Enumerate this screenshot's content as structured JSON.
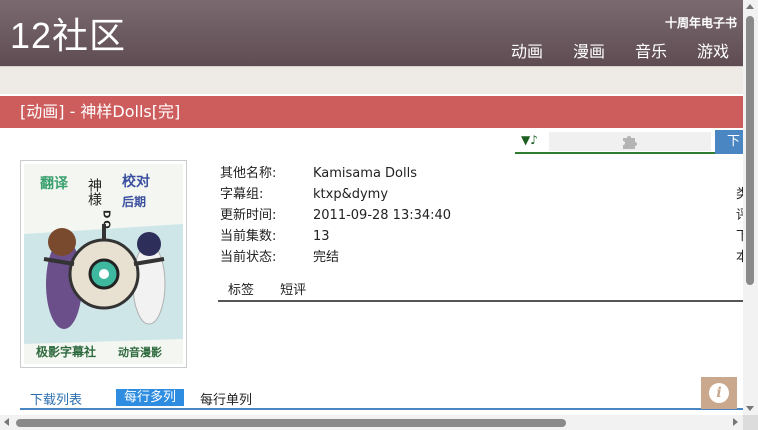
{
  "site": {
    "logo": "12社区",
    "tagline": "十周年电子书",
    "nav": [
      "动画",
      "漫画",
      "音乐",
      "游戏"
    ]
  },
  "page_title": "[动画] - 神样Dolls[完]",
  "player": {
    "note": "▼♪",
    "download_label": "下"
  },
  "cover": {
    "title_vertical": "神様",
    "title_latin": "DOLLS",
    "credits_left": [
      "翻译",
      "校对"
    ],
    "credits_right": [
      "后期"
    ],
    "bottom_left": "极影字幕社",
    "bottom_right": "动音漫影"
  },
  "info": {
    "rows": [
      {
        "key": "其他名称:",
        "value": "Kamisama Dolls"
      },
      {
        "key": "字幕组:",
        "value": "ktxp&dymy"
      },
      {
        "key": "更新时间:",
        "value": "2011-09-28 13:34:40"
      },
      {
        "key": "当前集数:",
        "value": "13"
      },
      {
        "key": "当前状态:",
        "value": "完结"
      }
    ],
    "edge_col": [
      "类",
      "评",
      "下",
      "本"
    ]
  },
  "tabs": [
    "标签",
    "短评"
  ],
  "download_list": {
    "title": "下载列表",
    "multi": "每行多列",
    "single": "每行单列"
  },
  "info_button": "i",
  "colors": {
    "header": "#6b5a60",
    "titlebar": "#cd5c5c",
    "accent": "#2e8de0"
  }
}
